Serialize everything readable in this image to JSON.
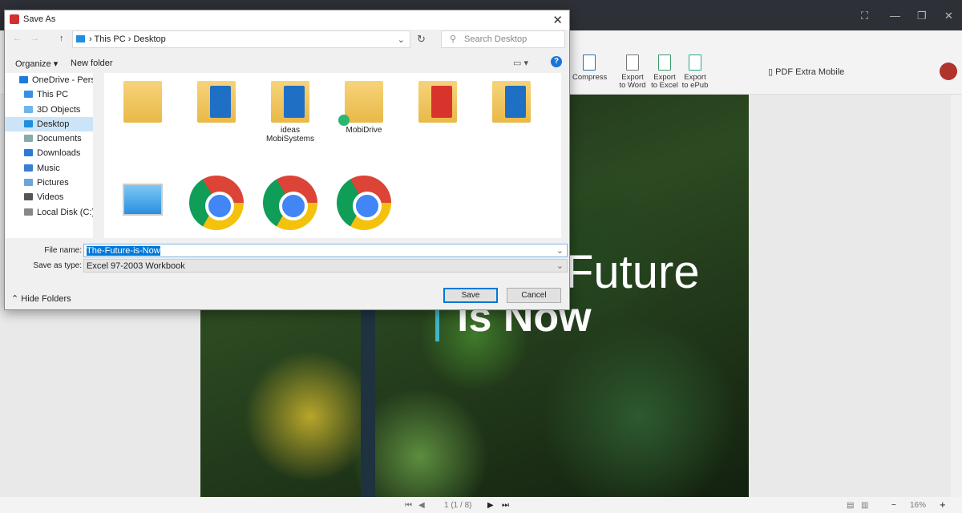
{
  "dialog": {
    "title": "Save As",
    "close": "✕",
    "nav_back": "←",
    "nav_forward": "→",
    "nav_up": "↑",
    "breadcrumb": [
      "This PC",
      "Desktop"
    ],
    "search_placeholder": "Search Desktop",
    "organize": "Organize ▾",
    "new_folder": "New folder",
    "nav_pane": [
      {
        "label": "OneDrive - Person",
        "color": "#1e7bd8"
      },
      {
        "label": "This PC",
        "color": "#3a8ee6"
      },
      {
        "label": "3D Objects",
        "color": "#6cb6f0"
      },
      {
        "label": "Desktop",
        "color": "#1f8de0",
        "selected": true
      },
      {
        "label": "Documents",
        "color": "#8aa"
      },
      {
        "label": "Downloads",
        "color": "#2b7bd6"
      },
      {
        "label": "Music",
        "color": "#3a7fd0"
      },
      {
        "label": "Pictures",
        "color": "#6aa6d8"
      },
      {
        "label": "Videos",
        "color": "#555"
      },
      {
        "label": "Local Disk (C:)",
        "color": "#888"
      }
    ],
    "files": [
      {
        "label": "",
        "kind": "folder"
      },
      {
        "label": "",
        "kind": "folder-doc"
      },
      {
        "label": "ideas MobiSystems",
        "kind": "folder-doc"
      },
      {
        "label": "MobiDrive",
        "kind": "folder-sync"
      },
      {
        "label": "",
        "kind": "folder-pdf"
      },
      {
        "label": "",
        "kind": "folder-doc"
      },
      {
        "label": "",
        "kind": "this-pc"
      },
      {
        "label": "",
        "kind": "chrome"
      },
      {
        "label": "",
        "kind": "chrome"
      },
      {
        "label": "",
        "kind": "chrome"
      }
    ],
    "file_name_label": "File name:",
    "file_name": "The-Future-is-Now",
    "save_type_label": "Save as type:",
    "save_type": "Excel 97-2003 Workbook",
    "hide_folders": "Hide Folders",
    "save": "Save",
    "cancel": "Cancel"
  },
  "app": {
    "mobile": "PDF Extra Mobile",
    "ribbon": [
      {
        "label": "Compress"
      },
      {
        "label": "Export to Word"
      },
      {
        "label": "Export to Excel"
      },
      {
        "label": "Export to ePub"
      }
    ],
    "page_text": {
      "line1": "Future",
      "line2": "is Now"
    },
    "status": {
      "page": "1 (1 / 8)",
      "zoom": "16%",
      "zoom_out": "−",
      "zoom_in": "+"
    }
  }
}
